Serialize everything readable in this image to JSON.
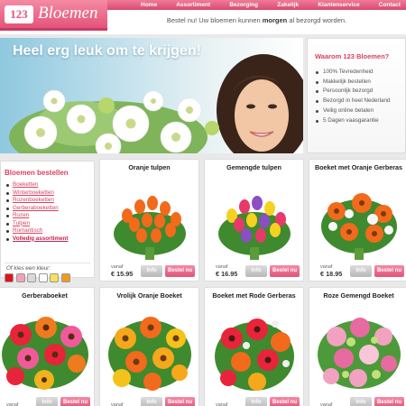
{
  "header": {
    "logo_number": "123",
    "logo_text": "Bloemen",
    "nav": [
      "Home",
      "Assortiment",
      "Bezorging",
      "Zakelijk",
      "Klantenservice",
      "Contact"
    ],
    "tagline_before": "Bestel nu! Uw bloemen kunnen ",
    "tagline_bold": "morgen",
    "tagline_after": " al bezorgd worden."
  },
  "hero": {
    "title": "Heel erg leuk om te krijgen!"
  },
  "info": {
    "title": "Waarom 123 Bloemen?",
    "items": [
      "100% Tevredenheid",
      "Makkelijk bestellen",
      "Persoonlijk bezorgd",
      "Bezorgd in heel Nederland",
      "Veilig online betalen",
      "5 Dagen vaasgarantie"
    ]
  },
  "sidebar": {
    "title": "Bloemen bestellen",
    "links": [
      "Boeketten",
      "Winterboeketten",
      "Rozenboeketten",
      "Gerberaboeketten",
      "Rozen",
      "Tulpen",
      "Romantisch",
      "Volledig assortiment"
    ],
    "color_title": "Of kies een kleur:",
    "colors": [
      "#e0131b",
      "#f3a1b4",
      "#d9d9d9",
      "#ffffff",
      "#f5e15a",
      "#f39a1b"
    ]
  },
  "products": [
    {
      "name": "Oranje tulpen",
      "vanaf": "vanaf",
      "price": "€ 15.95",
      "info": "Info",
      "bestel": "Bestel nu"
    },
    {
      "name": "Gemengde tulpen",
      "vanaf": "vanaf",
      "price": "€ 16.95",
      "info": "Info",
      "bestel": "Bestel nu"
    },
    {
      "name": "Boeket met Oranje Gerberas",
      "vanaf": "vanaf",
      "price": "€ 18.95",
      "info": "Info",
      "bestel": "Bestel nu"
    },
    {
      "name": "Gerberaboeket",
      "vanaf": "vanaf",
      "price": "",
      "info": "Info",
      "bestel": "Bestel nu"
    },
    {
      "name": "Vrolijk Oranje Boeket",
      "vanaf": "vanaf",
      "price": "",
      "info": "Info",
      "bestel": "Bestel nu"
    },
    {
      "name": "Boeket met Rode Gerberas",
      "vanaf": "vanaf",
      "price": "",
      "info": "Info",
      "bestel": "Bestel nu"
    },
    {
      "name": "Roze Gemengd Boeket",
      "vanaf": "vanaf",
      "price": "",
      "info": "Info",
      "bestel": "Bestel nu"
    }
  ]
}
